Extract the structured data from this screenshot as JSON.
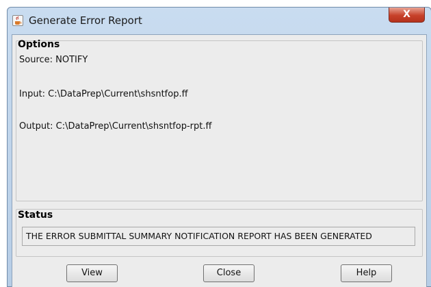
{
  "window": {
    "title": "Generate Error Report",
    "close_label": "X",
    "app_icon": "java-cup-icon"
  },
  "options": {
    "heading": "Options",
    "source": "Source: NOTIFY",
    "input": "Input:  C:\\DataPrep\\Current\\shsntfop.ff",
    "output": "Output: C:\\DataPrep\\Current\\shsntfop-rpt.ff"
  },
  "status": {
    "heading": "Status",
    "message": "THE ERROR SUBMITTAL SUMMARY NOTIFICATION REPORT HAS BEEN GENERATED"
  },
  "buttons": {
    "view": "View",
    "close": "Close",
    "help": "Help"
  },
  "colors": {
    "frame": "#c9dcf0",
    "close_button": "#c7412a",
    "client_bg": "#ececec"
  }
}
